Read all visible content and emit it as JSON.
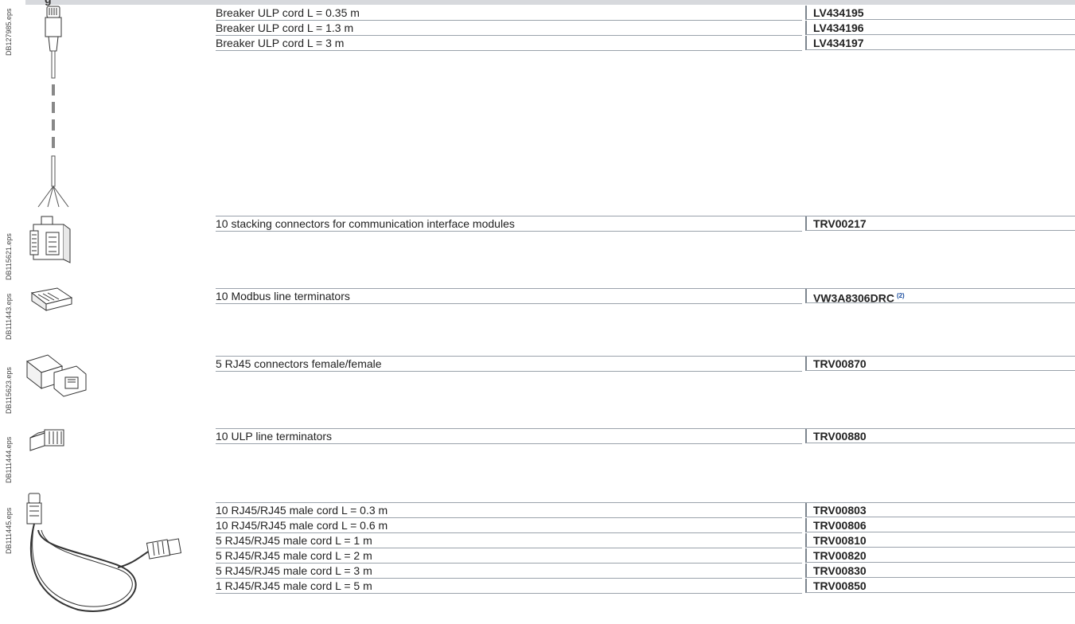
{
  "header": {
    "fragment": "g"
  },
  "image_labels": {
    "ulp_cord": "DB127985.eps",
    "stacking": "DB115621.eps",
    "modbus_term": "DB111443.eps",
    "rj45_conn": "DB115623.eps",
    "ulp_term": "DB111444.eps",
    "rj45_cord": "DB111445.eps"
  },
  "groups": {
    "breaker_cords": [
      {
        "desc": "Breaker ULP cord L = 0.35 m",
        "ref": "LV434195"
      },
      {
        "desc": "Breaker ULP cord L = 1.3 m",
        "ref": "LV434196"
      },
      {
        "desc": "Breaker ULP cord L = 3 m",
        "ref": "LV434197"
      }
    ],
    "stacking": [
      {
        "desc": "10 stacking connectors for communication interface modules",
        "ref": "TRV00217"
      }
    ],
    "modbus": [
      {
        "desc": "10 Modbus line terminators",
        "ref": "VW3A8306DRC",
        "note": "(2)"
      }
    ],
    "rj45_connectors": [
      {
        "desc": "5 RJ45 connectors female/female",
        "ref": "TRV00870"
      }
    ],
    "ulp_terminators": [
      {
        "desc": "10 ULP line terminators",
        "ref": "TRV00880"
      }
    ],
    "rj45_cords": [
      {
        "desc": "10 RJ45/RJ45 male cord L = 0.3 m",
        "ref": "TRV00803"
      },
      {
        "desc": "10 RJ45/RJ45 male cord L = 0.6 m",
        "ref": "TRV00806"
      },
      {
        "desc": "5 RJ45/RJ45 male cord L = 1 m",
        "ref": "TRV00810"
      },
      {
        "desc": "5 RJ45/RJ45 male cord L = 2 m",
        "ref": "TRV00820"
      },
      {
        "desc": "5 RJ45/RJ45 male cord L = 3 m",
        "ref": "TRV00830"
      },
      {
        "desc": "1 RJ45/RJ45 male cord L = 5 m",
        "ref": "TRV00850"
      }
    ]
  }
}
